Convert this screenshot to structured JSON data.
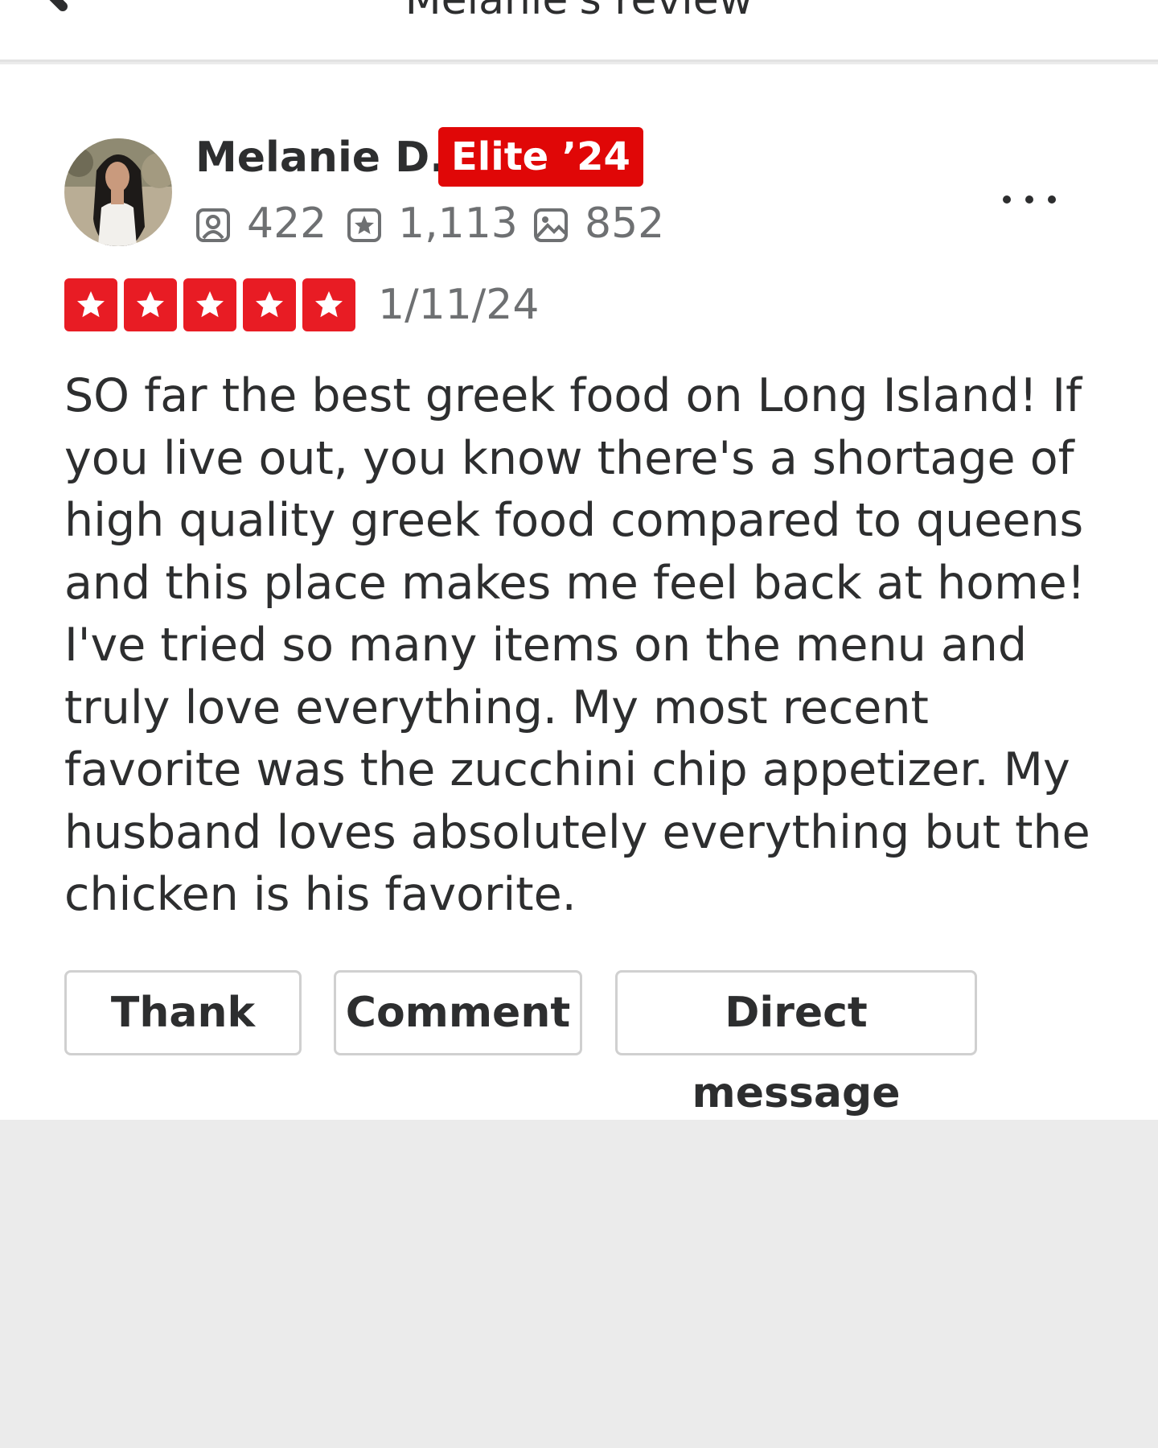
{
  "header": {
    "title": "Melanie's review",
    "back_icon": "back-arrow-icon"
  },
  "review": {
    "user": {
      "name": "Melanie D.",
      "badge": "Elite ’24",
      "friends": "422",
      "reviews": "1,113",
      "photos": "852"
    },
    "rating": 5,
    "date": "1/11/24",
    "text": "SO far the best greek food on Long Island! If you live out, you know there's a shortage of high quality greek food compared to queens and this place makes me feel back at home! I've tried so many items on the menu and truly love everything. My most recent favorite was the zucchini chip appetizer. My husband loves absolutely everything but the chicken is his favorite."
  },
  "actions": {
    "thank": "Thank",
    "comment": "Comment",
    "direct_message": "Direct message"
  },
  "colors": {
    "brand_red": "#e00707",
    "star_red": "#e81c24",
    "text": "#2d2e2f",
    "muted": "#6e7072"
  }
}
